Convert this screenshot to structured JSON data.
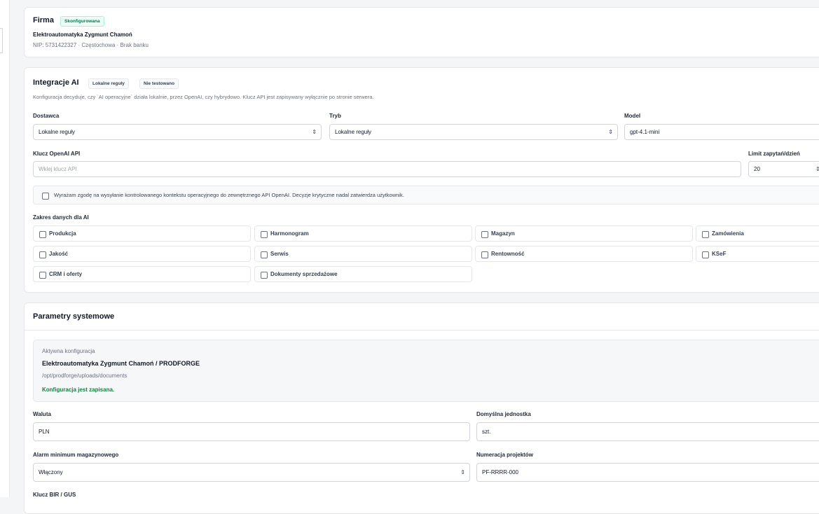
{
  "firma": {
    "title": "Firma",
    "badge": "Skonfigurowana",
    "company_name": "Elektroautomatyka Zygmunt Chamoń",
    "details": "NIP: 5731422327 · Częstochowa · Brak banku"
  },
  "ai": {
    "title": "Integracje AI",
    "badges": [
      "Lokalne reguły",
      "Nie testowano"
    ],
    "description": "Konfiguracja decyduje, czy `AI operacyjne` działa lokalnie, przez OpenAI, czy hybrydowo. Klucz API jest zapisywany wyłącznie po stronie serwera.",
    "provider": {
      "label": "Dostawca",
      "value": "Lokalne reguły"
    },
    "mode": {
      "label": "Tryb",
      "value": "Lokalne reguły"
    },
    "model": {
      "label": "Model",
      "value": "gpt-4.1-mini"
    },
    "api_key": {
      "label": "Klucz OpenAI API",
      "value": "",
      "placeholder": "Wklej klucz API"
    },
    "limit": {
      "label": "Limit zapytań/dzień",
      "value": "20"
    },
    "consent": {
      "text": "Wyrażam zgodę na wysyłanie kontrolowanego kontekstu operacyjnego do zewnętrznego API OpenAI. Decyzje krytyczne nadal zatwierdza użytkownik.",
      "checked": false
    },
    "scope_label": "Zakres danych dla AI",
    "scope": [
      {
        "label": "Produkcja",
        "checked": false
      },
      {
        "label": "Harmonogram",
        "checked": false
      },
      {
        "label": "Magazyn",
        "checked": false
      },
      {
        "label": "Zamówienia",
        "checked": false
      },
      {
        "label": "Jakość",
        "checked": false
      },
      {
        "label": "Serwis",
        "checked": false
      },
      {
        "label": "Rentowność",
        "checked": false
      },
      {
        "label": "KSeF",
        "checked": false
      },
      {
        "label": "CRM i oferty",
        "checked": false
      },
      {
        "label": "Dokumenty sprzedażowe",
        "checked": false
      }
    ]
  },
  "system": {
    "title": "Parametry systemowe",
    "active": {
      "label": "Aktywna konfiguracja",
      "name": "Elektroautomatyka Zygmunt Chamoń / PRODFORGE",
      "path": "/opt/prodforge/uploads/documents",
      "status": "Konfiguracja jest zapisana."
    },
    "currency": {
      "label": "Waluta",
      "value": "PLN"
    },
    "unit": {
      "label": "Domyślna jednostka",
      "value": "szt."
    },
    "stock_alarm": {
      "label": "Alarm minimum magazynowego",
      "value": "Włączony"
    },
    "project_numbering": {
      "label": "Numeracja projektów",
      "value": "PF-RRRR-000"
    },
    "bir_key": {
      "label": "Klucz BIR / GUS"
    }
  },
  "colors": {
    "background": "#f4f5f7",
    "card": "#ffffff",
    "success": "#15803d",
    "badge_success_bg": "#ecfdf5"
  }
}
